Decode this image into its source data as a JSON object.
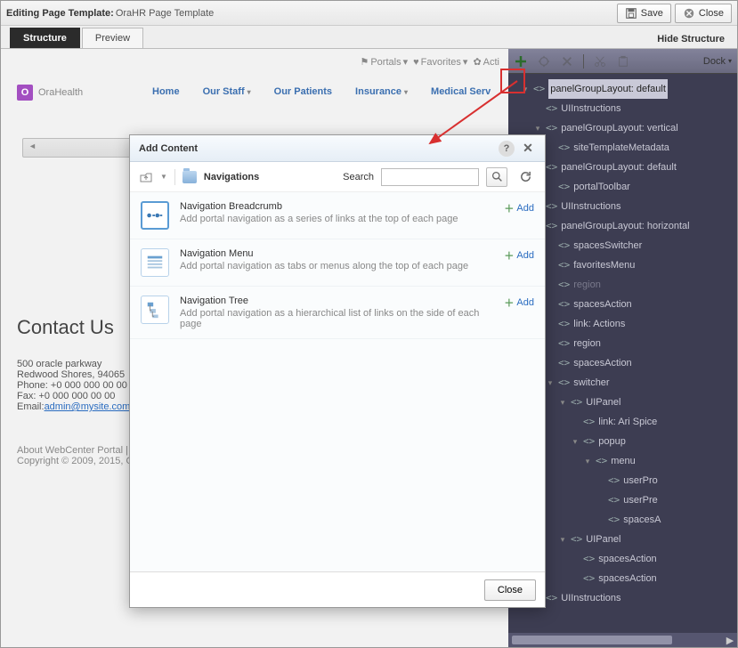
{
  "topbar": {
    "prefix": "Editing Page Template:",
    "name": "OraHR Page Template",
    "save": "Save",
    "close": "Close"
  },
  "tabs": {
    "structure": "Structure",
    "preview": "Preview",
    "hide": "Hide Structure"
  },
  "minibar": {
    "portals": "Portals",
    "favorites": "Favorites",
    "actions": "Acti"
  },
  "brand": {
    "logo": "O",
    "name": "OraHealth"
  },
  "nav": {
    "home": "Home",
    "staff": "Our Staff",
    "patients": "Our Patients",
    "insurance": "Insurance",
    "medserv": "Medical Serv"
  },
  "contact": {
    "heading": "Contact Us",
    "addr1": "500 oracle parkway",
    "addr2": "Redwood Shores, 94065",
    "phone_lbl": "Phone: ",
    "phone": "+0 000 000 00 00",
    "fax_lbl": "Fax: ",
    "fax": "+0 000 000 00 00",
    "email_lbl": "Email:",
    "email": "admin@mysite.com"
  },
  "about": {
    "line1": "About WebCenter Portal |",
    "line2": "Copyright © 2009, 2015, O"
  },
  "struct_toolbar": {
    "dock": "Dock"
  },
  "tree": [
    {
      "ind": 1,
      "tg": "▾",
      "name": "panelGroupLayout: default",
      "sel": true
    },
    {
      "ind": 2,
      "tg": "",
      "name": "UIInstructions"
    },
    {
      "ind": 2,
      "tg": "▾",
      "name": "panelGroupLayout: vertical"
    },
    {
      "ind": 3,
      "tg": "",
      "name": "siteTemplateMetadata"
    },
    {
      "ind": 2,
      "tg": "▾",
      "name": "panelGroupLayout: default"
    },
    {
      "ind": 3,
      "tg": "",
      "name": "portalToolbar"
    },
    {
      "ind": 2,
      "tg": "",
      "name": "UIInstructions"
    },
    {
      "ind": 2,
      "tg": "▾",
      "name": "panelGroupLayout: horizontal"
    },
    {
      "ind": 3,
      "tg": "",
      "name": "spacesSwitcher"
    },
    {
      "ind": 3,
      "tg": "",
      "name": "favoritesMenu"
    },
    {
      "ind": 3,
      "tg": "",
      "name": "region",
      "dim": true
    },
    {
      "ind": 3,
      "tg": "",
      "name": "spacesAction"
    },
    {
      "ind": 3,
      "tg": "",
      "name": "link: Actions"
    },
    {
      "ind": 3,
      "tg": "",
      "name": "region"
    },
    {
      "ind": 3,
      "tg": "",
      "name": "spacesAction"
    },
    {
      "ind": 3,
      "tg": "▾",
      "name": "switcher"
    },
    {
      "ind": 4,
      "tg": "▾",
      "name": "UIPanel"
    },
    {
      "ind": 5,
      "tg": "",
      "name": "link: Ari Spice"
    },
    {
      "ind": 5,
      "tg": "▾",
      "name": "popup"
    },
    {
      "ind": 6,
      "tg": "▾",
      "name": "menu"
    },
    {
      "ind": 7,
      "tg": "",
      "name": "userPro"
    },
    {
      "ind": 7,
      "tg": "",
      "name": "userPre"
    },
    {
      "ind": 7,
      "tg": "",
      "name": "spacesA"
    },
    {
      "ind": 4,
      "tg": "▾",
      "name": "UIPanel"
    },
    {
      "ind": 5,
      "tg": "",
      "name": "spacesAction"
    },
    {
      "ind": 5,
      "tg": "",
      "name": "spacesAction"
    },
    {
      "ind": 2,
      "tg": "",
      "name": "UIInstructions"
    }
  ],
  "dialog": {
    "title": "Add Content",
    "crumb": "Navigations",
    "search_label": "Search",
    "search_placeholder": "",
    "add_label": "Add",
    "close": "Close",
    "items": [
      {
        "title": "Navigation Breadcrumb",
        "desc": "Add portal navigation as a series of links at the top of each page",
        "sel": true
      },
      {
        "title": "Navigation Menu",
        "desc": "Add portal navigation as tabs or menus along the top of each page"
      },
      {
        "title": "Navigation Tree",
        "desc": "Add portal navigation as a hierarchical list of links on the side of each page"
      }
    ]
  }
}
